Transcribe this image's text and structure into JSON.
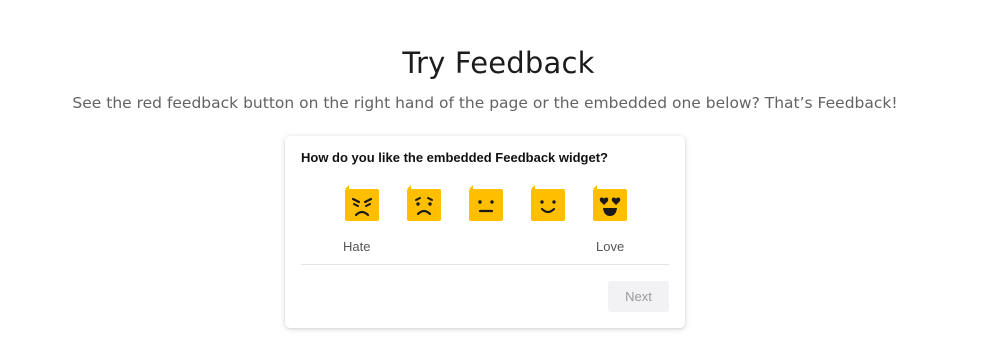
{
  "page": {
    "title": "Try Feedback",
    "subtitle": "See the red feedback button on the right hand of the page or the embedded one below? That’s Feedback!"
  },
  "widget": {
    "question": "How do you like the embedded Feedback widget?",
    "ratings": [
      {
        "icon": "angry-face-icon",
        "level": 1
      },
      {
        "icon": "sad-face-icon",
        "level": 2
      },
      {
        "icon": "neutral-face-icon",
        "level": 3
      },
      {
        "icon": "smile-face-icon",
        "level": 4
      },
      {
        "icon": "heart-eyes-face-icon",
        "level": 5
      }
    ],
    "scale_low_label": "Hate",
    "scale_high_label": "Love",
    "next_label": "Next",
    "colors": {
      "face_fill": "#FFBF00",
      "face_features": "#1a1a1a",
      "next_bg": "#F2F2F4",
      "next_text": "#9A9A9A"
    }
  }
}
